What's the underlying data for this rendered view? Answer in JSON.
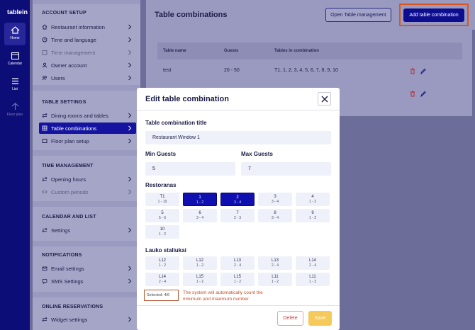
{
  "app": {
    "logo": "tablein"
  },
  "rail": [
    {
      "label": "Home",
      "icon": "home-icon"
    },
    {
      "label": "Calendar",
      "icon": "calendar-icon"
    },
    {
      "label": "List",
      "icon": "list-icon"
    },
    {
      "label": "Floor plan",
      "icon": "floor-plan-icon"
    }
  ],
  "sidebar": {
    "account": {
      "title": "ACCOUNT SETUP",
      "items": [
        {
          "label": "Restaurant information",
          "icon": "home-icon"
        },
        {
          "label": "Time and language",
          "icon": "clock-icon"
        },
        {
          "label": "Time management",
          "icon": "calendar-icon"
        },
        {
          "label": "Owner account",
          "icon": "user-icon"
        },
        {
          "label": "Users",
          "icon": "users-icon"
        }
      ]
    },
    "table": {
      "title": "TABLE SETTINGS",
      "items": [
        {
          "label": "Dining rooms and tables",
          "icon": "swap-icon"
        },
        {
          "label": "Table combinations",
          "icon": "grid-icon"
        },
        {
          "label": "Floor plan setup",
          "icon": "floor-icon"
        }
      ]
    },
    "time": {
      "title": "TIME MANAGEMENT",
      "items": [
        {
          "label": "Opening hours",
          "icon": "swap-icon"
        },
        {
          "label": "Custom periods",
          "icon": "code-icon"
        }
      ]
    },
    "calendar": {
      "title": "CALENDAR AND LIST",
      "items": [
        {
          "label": "Settings",
          "icon": "swap-icon"
        }
      ]
    },
    "notifications": {
      "title": "NOTIFICATIONS",
      "items": [
        {
          "label": "Email settings",
          "icon": "mail-icon"
        },
        {
          "label": "SMS Settings",
          "icon": "sms-icon"
        }
      ]
    },
    "online": {
      "title": "ONLINE RESERVATIONS",
      "items": [
        {
          "label": "Widget settings",
          "icon": "swap-icon"
        }
      ]
    }
  },
  "main": {
    "title": "Table combinations",
    "open_table_management": "Open Table management",
    "add_table_combination": "Add table combination",
    "columns": [
      "Table name",
      "Guests",
      "Tables in combination"
    ],
    "rows": [
      {
        "name": "test",
        "guests": "20 - 50",
        "tables": "T1, 1, 2, 3, 4, 5, 6, 7, 8, 9, 10"
      }
    ]
  },
  "modal": {
    "title": "Edit table combination",
    "combination_title_label": "Table combination title",
    "combination_title_value": "Restaurant Window 1",
    "min_guests_label": "Min Guests",
    "min_guests_value": "5",
    "max_guests_label": "Max Guests",
    "max_guests_value": "7",
    "sections": [
      {
        "name": "Restoranas",
        "tables": [
          {
            "name": "T1",
            "range": "1 - 10",
            "selected": false
          },
          {
            "name": "1",
            "range": "1 - 2",
            "selected": true
          },
          {
            "name": "2",
            "range": "3 - 4",
            "selected": true
          },
          {
            "name": "3",
            "range": "3 - 4",
            "selected": false
          },
          {
            "name": "4",
            "range": "1 - 2",
            "selected": false
          },
          {
            "name": "5",
            "range": "5 - 6",
            "selected": false
          },
          {
            "name": "6",
            "range": "3 - 4",
            "selected": false
          },
          {
            "name": "7",
            "range": "2 - 3",
            "selected": false
          },
          {
            "name": "8",
            "range": "3 - 4",
            "selected": false
          },
          {
            "name": "9",
            "range": "1 - 2",
            "selected": false
          },
          {
            "name": "10",
            "range": "1 - 2",
            "selected": false
          }
        ]
      },
      {
        "name": "Lauko staliukai",
        "tables": [
          {
            "name": "L12",
            "range": "1 - 2",
            "selected": false
          },
          {
            "name": "L12",
            "range": "1 - 2",
            "selected": false
          },
          {
            "name": "L13",
            "range": "2 - 4",
            "selected": false
          },
          {
            "name": "L13",
            "range": "2 - 4",
            "selected": false
          },
          {
            "name": "L14",
            "range": "2 - 4",
            "selected": false
          },
          {
            "name": "L14",
            "range": "2 - 4",
            "selected": false
          },
          {
            "name": "L15",
            "range": "1 - 2",
            "selected": false
          },
          {
            "name": "L15",
            "range": "1 - 2",
            "selected": false
          },
          {
            "name": "L11",
            "range": "1 - 2",
            "selected": false
          },
          {
            "name": "L11",
            "range": "1 - 2",
            "selected": false
          }
        ]
      }
    ],
    "selected_text": "Selected: 4/6",
    "annotation": "The system will automatically count the minimum and maximum number",
    "delete_label": "Delete",
    "save_label": "Save"
  },
  "colors": {
    "brand": "#0d0d90",
    "annotation": "#c0522a",
    "save": "#f5c95a",
    "delete": "#c03a3a"
  }
}
